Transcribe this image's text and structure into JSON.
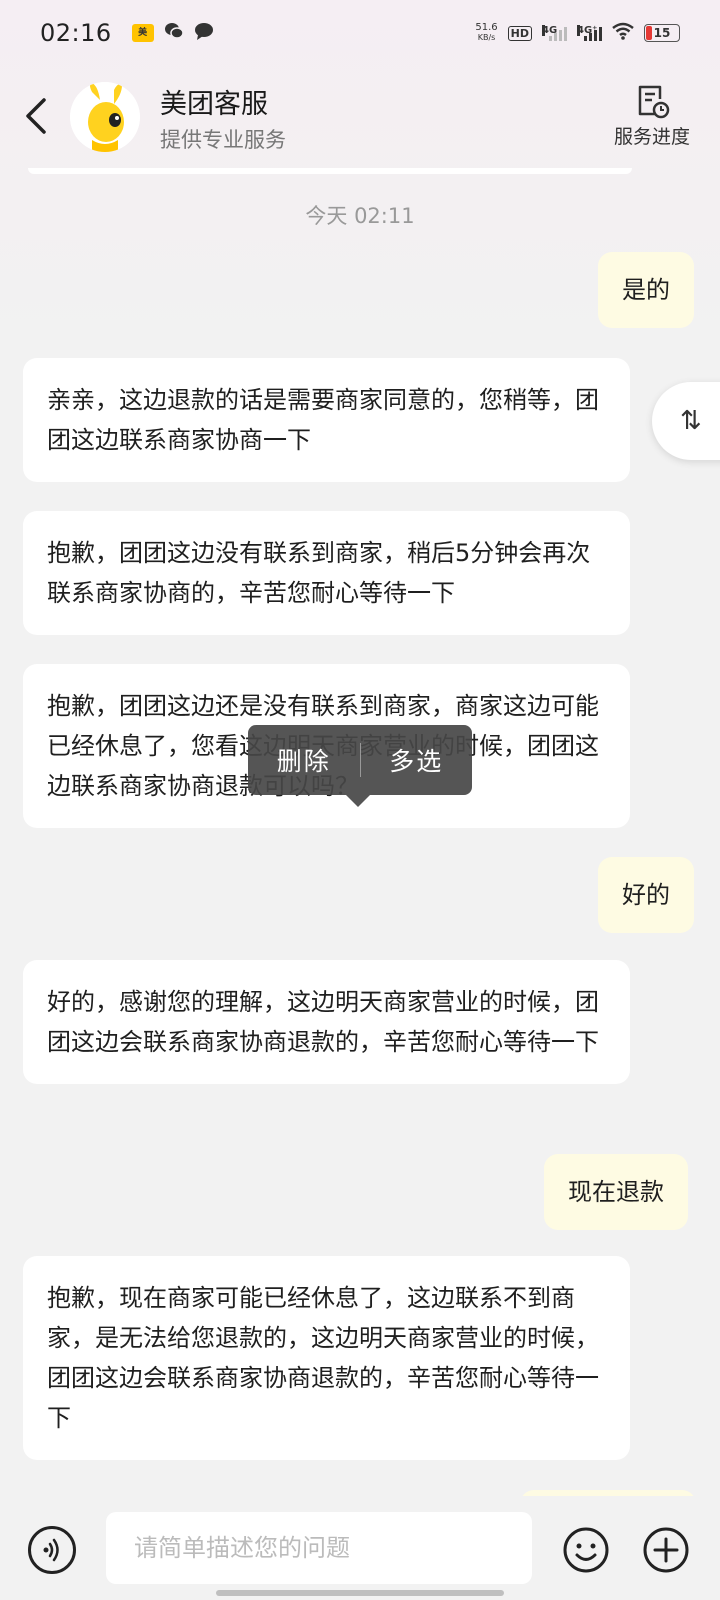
{
  "status_bar": {
    "time": "02:16",
    "net_speed_value": "51.6",
    "net_speed_unit": "KB/s",
    "hd_label": "HD",
    "net_1": "4G",
    "net_2": "4G⁺",
    "battery": "15",
    "battery_color": "#e53935"
  },
  "header": {
    "title": "美团客服",
    "subtitle": "提供专业服务",
    "progress_label": "服务进度",
    "back_icon": "chevron-left-icon",
    "progress_icon": "document-clock-icon"
  },
  "chat": {
    "timestamp": "今天 02:11",
    "messages": [
      {
        "side": "right",
        "text": "是的"
      },
      {
        "side": "left",
        "text": "亲亲，这边退款的话是需要商家同意的，您稍等，团团这边联系商家协商一下"
      },
      {
        "side": "left",
        "text": "抱歉，团团这边没有联系到商家，稍后5分钟会再次联系商家协商的，辛苦您耐心等待一下"
      },
      {
        "side": "left",
        "text": "抱歉，团团这边还是没有联系到商家，商家这边可能已经休息了，您看这边明天商家营业的时候，团团这边联系商家协商退款可以吗？"
      },
      {
        "side": "right",
        "text": "好的"
      },
      {
        "side": "left",
        "text": "好的，感谢您的理解，这边明天商家营业的时候，团团这边会联系商家协商退款的，辛苦您耐心等待一下"
      },
      {
        "side": "right",
        "text": "现在退款"
      },
      {
        "side": "left",
        "text": "抱歉，现在商家可能已经休息了，这边联系不到商家，是无法给您退款的，这边明天商家营业的时候，团团这边会联系商家协商退款的，辛苦您耐心等待一下"
      }
    ],
    "context_menu": {
      "delete": "删除",
      "multi_select": "多选"
    },
    "scroll_toggle_symbol": "⇅"
  },
  "input_bar": {
    "placeholder": "请简单描述您的问题",
    "voice_icon": "voice-icon",
    "emoji_icon": "emoji-icon",
    "add_icon": "plus-circle-icon"
  },
  "colors": {
    "right_bubble": "#fefbe3",
    "left_bubble": "#ffffff",
    "background": "#f2f2f2"
  }
}
